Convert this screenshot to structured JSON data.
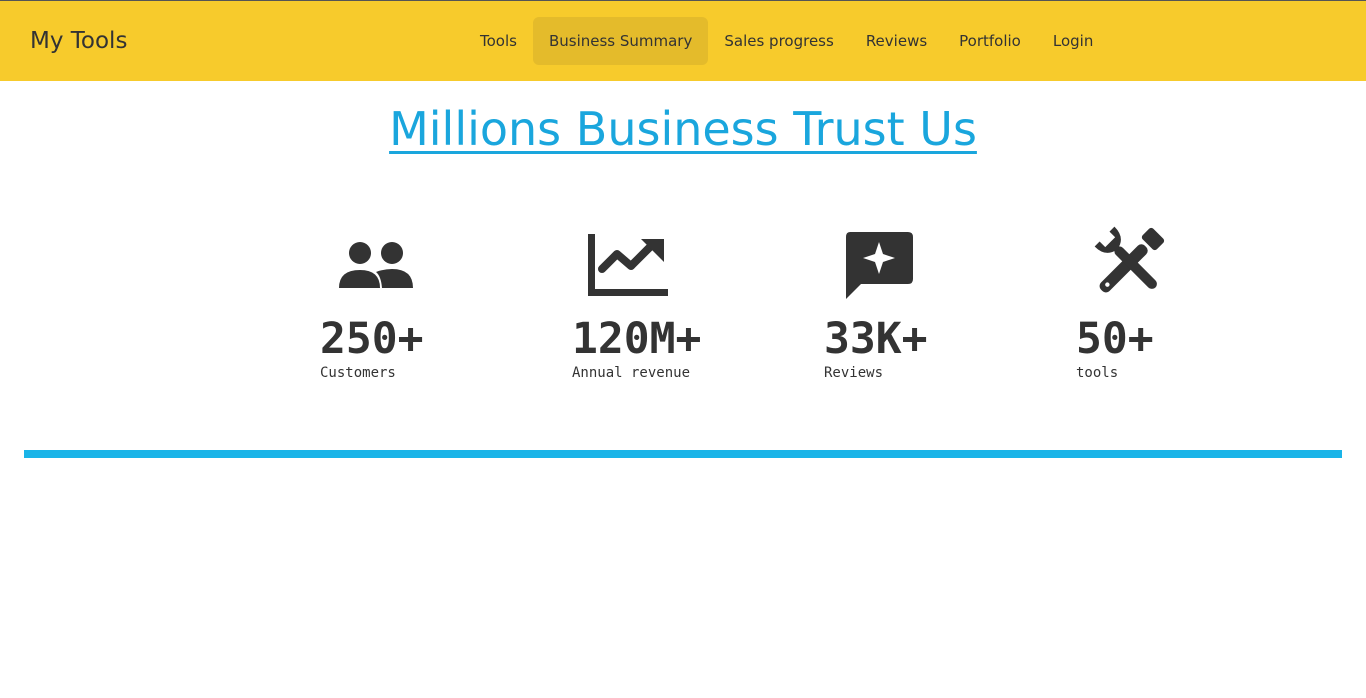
{
  "navbar": {
    "brand": "My Tools",
    "items": [
      {
        "label": "Tools",
        "active": false
      },
      {
        "label": "Business Summary",
        "active": true
      },
      {
        "label": "Sales progress",
        "active": false
      },
      {
        "label": "Reviews",
        "active": false
      },
      {
        "label": "Portfolio",
        "active": false
      },
      {
        "label": "Login",
        "active": false
      }
    ]
  },
  "hero": {
    "title": "Millions Business Trust Us"
  },
  "stats": [
    {
      "icon": "users-icon",
      "value": "250+",
      "label": "Customers"
    },
    {
      "icon": "chart-line-icon",
      "value": "120M+",
      "label": "Annual revenue"
    },
    {
      "icon": "review-star-icon",
      "value": "33K+",
      "label": "Reviews"
    },
    {
      "icon": "tools-icon",
      "value": "50+",
      "label": "tools"
    }
  ],
  "colors": {
    "navbar_bg": "#f7cb2c",
    "nav_active_bg": "#e4bb2b",
    "accent": "#1ab4e8",
    "title": "#1aa6dd",
    "text": "#333333"
  }
}
